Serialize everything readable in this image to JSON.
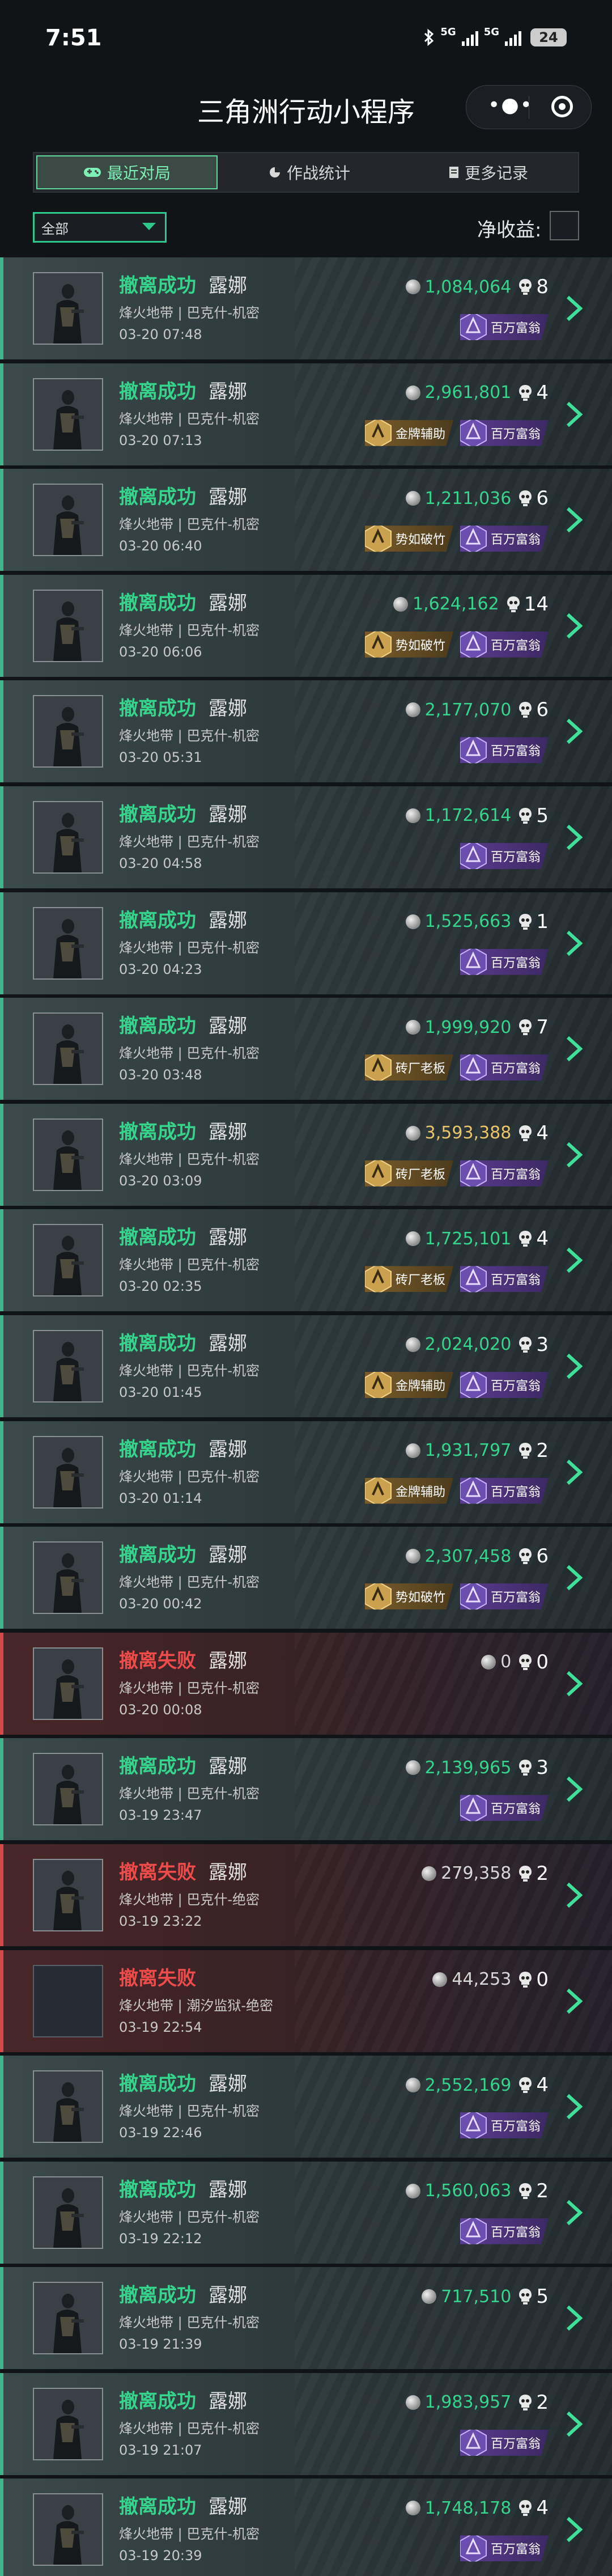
{
  "status_bar": {
    "time": "7:51",
    "network": "5G",
    "battery": "24"
  },
  "header": {
    "title": "三角洲行动小程序"
  },
  "tabs": [
    {
      "label": "最近对局",
      "icon": "gamepad-icon"
    },
    {
      "label": "作战统计",
      "icon": "pie-chart-icon"
    },
    {
      "label": "更多记录",
      "icon": "document-icon"
    }
  ],
  "filter": {
    "selected": "全部"
  },
  "net_income_label": "净收益:",
  "rows": [
    {
      "result": "撤离成功",
      "operator": "露娜",
      "map": "烽火地带 | 巴克什-机密",
      "time": "03-20 07:48",
      "value": "1,084,064",
      "kills": "8",
      "badges": [
        "百万富翁"
      ]
    },
    {
      "result": "撤离成功",
      "operator": "露娜",
      "map": "烽火地带 | 巴克什-机密",
      "time": "03-20 07:13",
      "value": "2,961,801",
      "kills": "4",
      "badges": [
        "金牌辅助",
        "百万富翁"
      ]
    },
    {
      "result": "撤离成功",
      "operator": "露娜",
      "map": "烽火地带 | 巴克什-机密",
      "time": "03-20 06:40",
      "value": "1,211,036",
      "kills": "6",
      "badges": [
        "势如破竹",
        "百万富翁"
      ]
    },
    {
      "result": "撤离成功",
      "operator": "露娜",
      "map": "烽火地带 | 巴克什-机密",
      "time": "03-20 06:06",
      "value": "1,624,162",
      "kills": "14",
      "badges": [
        "势如破竹",
        "百万富翁"
      ]
    },
    {
      "result": "撤离成功",
      "operator": "露娜",
      "map": "烽火地带 | 巴克什-机密",
      "time": "03-20 05:31",
      "value": "2,177,070",
      "kills": "6",
      "badges": [
        "百万富翁"
      ]
    },
    {
      "result": "撤离成功",
      "operator": "露娜",
      "map": "烽火地带 | 巴克什-机密",
      "time": "03-20 04:58",
      "value": "1,172,614",
      "kills": "5",
      "badges": [
        "百万富翁"
      ]
    },
    {
      "result": "撤离成功",
      "operator": "露娜",
      "map": "烽火地带 | 巴克什-机密",
      "time": "03-20 04:23",
      "value": "1,525,663",
      "kills": "1",
      "badges": [
        "百万富翁"
      ]
    },
    {
      "result": "撤离成功",
      "operator": "露娜",
      "map": "烽火地带 | 巴克什-机密",
      "time": "03-20 03:48",
      "value": "1,999,920",
      "kills": "7",
      "badges": [
        "砖厂老板",
        "百万富翁"
      ]
    },
    {
      "result": "撤离成功",
      "operator": "露娜",
      "map": "烽火地带 | 巴克什-机密",
      "time": "03-20 03:09",
      "value": "3,593,388",
      "kills": "4",
      "badges": [
        "砖厂老板",
        "百万富翁"
      ],
      "gold": true
    },
    {
      "result": "撤离成功",
      "operator": "露娜",
      "map": "烽火地带 | 巴克什-机密",
      "time": "03-20 02:35",
      "value": "1,725,101",
      "kills": "4",
      "badges": [
        "砖厂老板",
        "百万富翁"
      ]
    },
    {
      "result": "撤离成功",
      "operator": "露娜",
      "map": "烽火地带 | 巴克什-机密",
      "time": "03-20 01:45",
      "value": "2,024,020",
      "kills": "3",
      "badges": [
        "金牌辅助",
        "百万富翁"
      ]
    },
    {
      "result": "撤离成功",
      "operator": "露娜",
      "map": "烽火地带 | 巴克什-机密",
      "time": "03-20 01:14",
      "value": "1,931,797",
      "kills": "2",
      "badges": [
        "金牌辅助",
        "百万富翁"
      ]
    },
    {
      "result": "撤离成功",
      "operator": "露娜",
      "map": "烽火地带 | 巴克什-机密",
      "time": "03-20 00:42",
      "value": "2,307,458",
      "kills": "6",
      "badges": [
        "势如破竹",
        "百万富翁"
      ]
    },
    {
      "result": "撤离失败",
      "operator": "露娜",
      "map": "烽火地带 | 巴克什-机密",
      "time": "03-20 00:08",
      "value": "0",
      "kills": "0",
      "badges": [],
      "fail": true
    },
    {
      "result": "撤离成功",
      "operator": "露娜",
      "map": "烽火地带 | 巴克什-机密",
      "time": "03-19 23:47",
      "value": "2,139,965",
      "kills": "3",
      "badges": [
        "百万富翁"
      ]
    },
    {
      "result": "撤离失败",
      "operator": "露娜",
      "map": "烽火地带 | 巴克什-绝密",
      "time": "03-19 23:22",
      "value": "279,358",
      "kills": "2",
      "badges": [],
      "fail": true
    },
    {
      "result": "撤离失败",
      "operator": "",
      "map": "烽火地带 | 潮汐监狱-绝密",
      "time": "03-19 22:54",
      "value": "44,253",
      "kills": "0",
      "badges": [],
      "fail": true,
      "empty_avatar": true
    },
    {
      "result": "撤离成功",
      "operator": "露娜",
      "map": "烽火地带 | 巴克什-机密",
      "time": "03-19 22:46",
      "value": "2,552,169",
      "kills": "4",
      "badges": [
        "百万富翁"
      ]
    },
    {
      "result": "撤离成功",
      "operator": "露娜",
      "map": "烽火地带 | 巴克什-机密",
      "time": "03-19 22:12",
      "value": "1,560,063",
      "kills": "2",
      "badges": [
        "百万富翁"
      ]
    },
    {
      "result": "撤离成功",
      "operator": "露娜",
      "map": "烽火地带 | 巴克什-机密",
      "time": "03-19 21:39",
      "value": "717,510",
      "kills": "5",
      "badges": []
    },
    {
      "result": "撤离成功",
      "operator": "露娜",
      "map": "烽火地带 | 巴克什-机密",
      "time": "03-19 21:07",
      "value": "1,983,957",
      "kills": "2",
      "badges": [
        "百万富翁"
      ]
    },
    {
      "result": "撤离成功",
      "operator": "露娜",
      "map": "烽火地带 | 巴克什-机密",
      "time": "03-19 20:39",
      "value": "1,748,178",
      "kills": "4",
      "badges": [
        "百万富翁"
      ]
    }
  ]
}
